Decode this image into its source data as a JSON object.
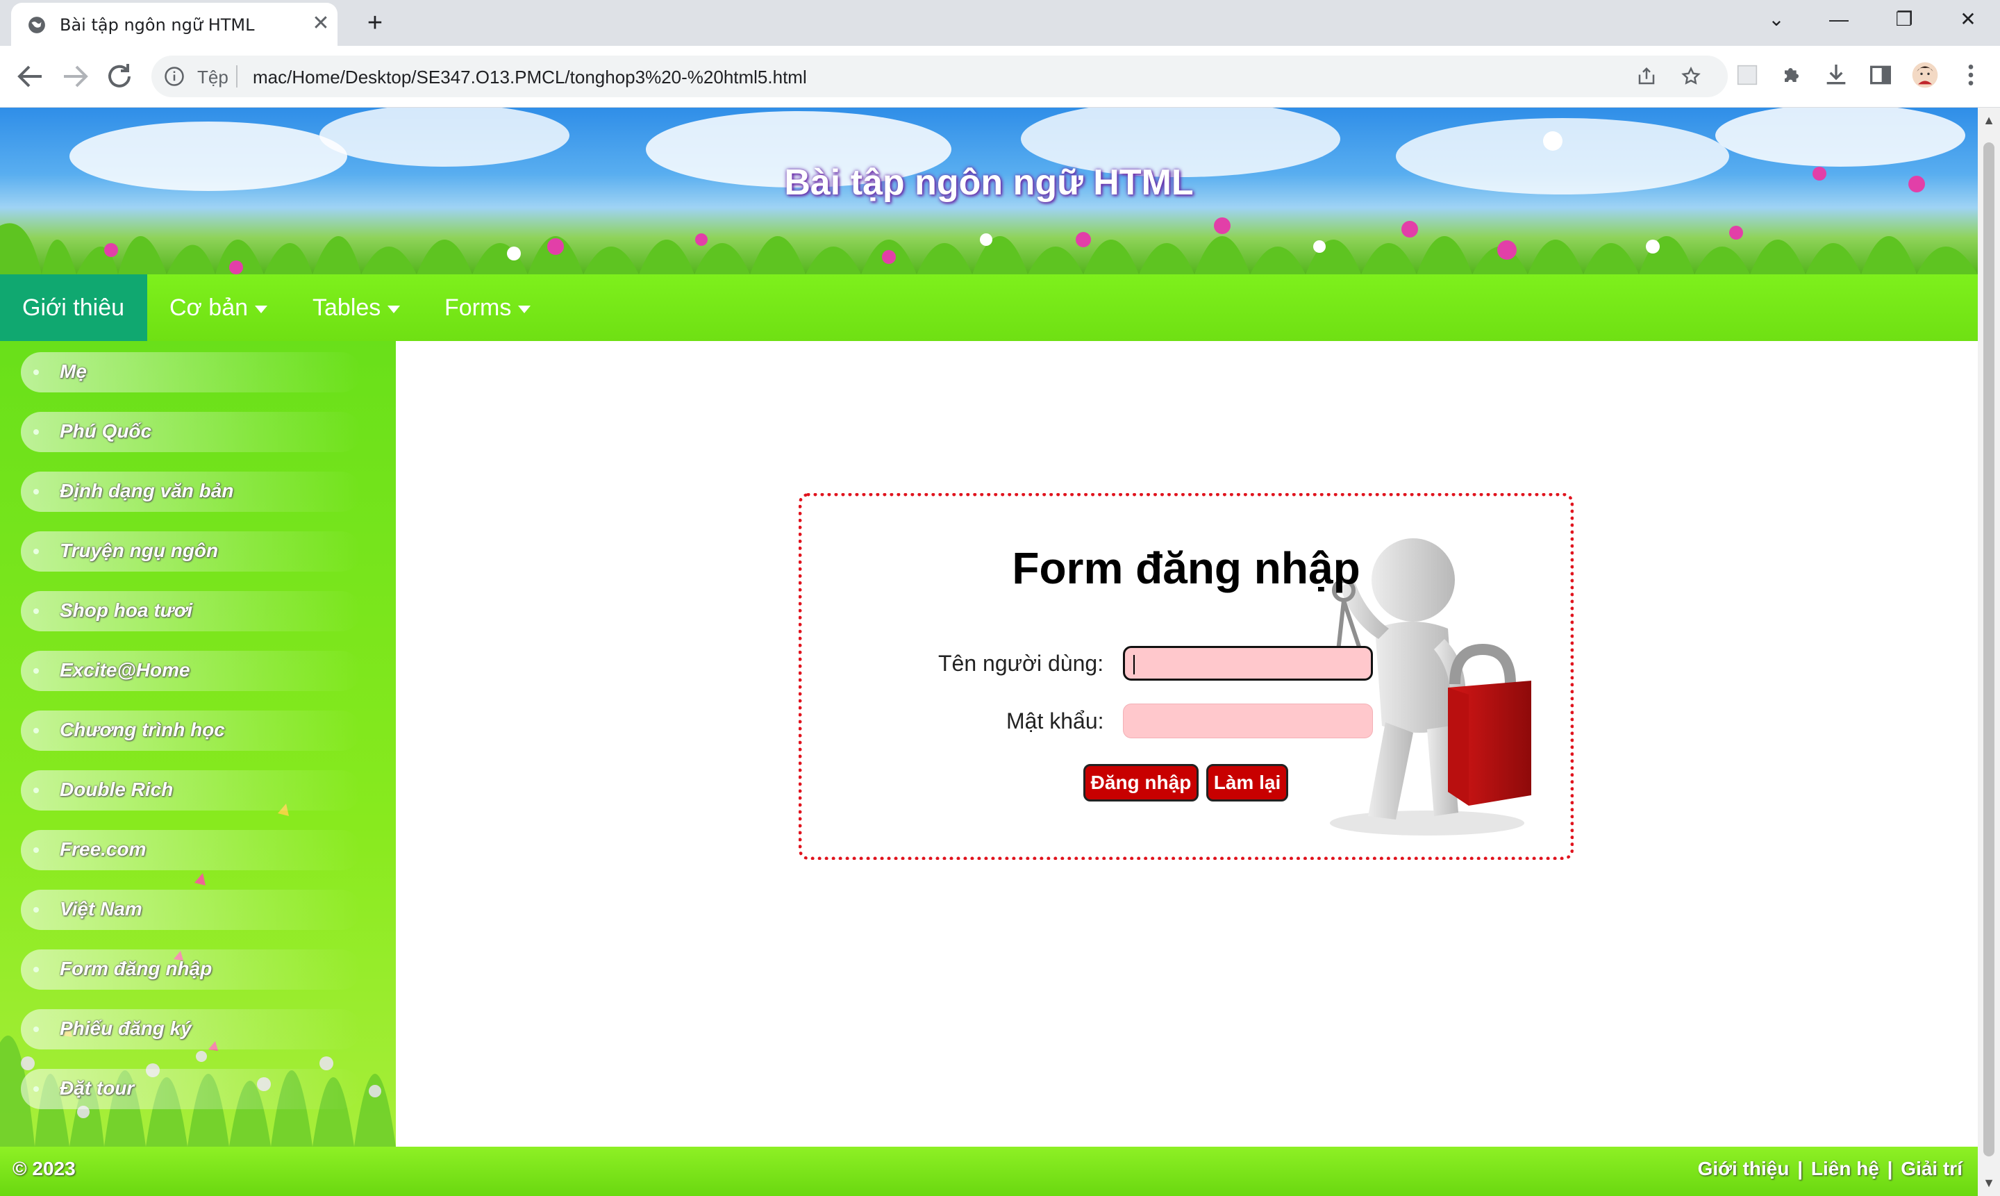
{
  "browser": {
    "tab_title": "Bài tập ngôn ngữ HTML",
    "close_glyph": "✕",
    "new_tab_glyph": "+",
    "minimize_glyph": "—",
    "restore_glyph": "❐",
    "window_close_glyph": "✕",
    "dropdown_glyph": "⌄",
    "site_info_label": "Tệp",
    "url": "mac/Home/Desktop/SE347.O13.PMCL/tonghop3%20-%20html5.html",
    "accent_color": "#1a73e8"
  },
  "header": {
    "title": "Bài tập ngôn ngữ HTML"
  },
  "menu": {
    "items": [
      {
        "label": "Giới thiêu",
        "active": true
      },
      {
        "label": "Cơ bản",
        "has_dropdown": true
      },
      {
        "label": "Tables",
        "has_dropdown": true
      },
      {
        "label": "Forms",
        "has_dropdown": true
      }
    ],
    "active_color": "#10a870"
  },
  "sidebar": {
    "items": [
      {
        "label": "Mẹ"
      },
      {
        "label": "Phú Quốc"
      },
      {
        "label": "Định dạng văn bản"
      },
      {
        "label": "Truyện ngụ ngôn"
      },
      {
        "label": "Shop hoa tươi"
      },
      {
        "label": "Excite@Home"
      },
      {
        "label": "Chương trình học"
      },
      {
        "label": "Double Rich"
      },
      {
        "label": "Free.com"
      },
      {
        "label": "Việt Nam"
      },
      {
        "label": "Form đăng nhập"
      },
      {
        "label": "Phiếu đăng ký"
      },
      {
        "label": "Đặt tour"
      }
    ]
  },
  "login_form": {
    "title": "Form đăng nhập",
    "username_label": "Tên người dùng:",
    "username_value": "",
    "password_label": "Mật khẩu:",
    "password_value": "",
    "login_button": "Đăng nhập",
    "reset_button": "Làm lại",
    "border_color": "#e0141e",
    "input_color": "#ffc8cc",
    "button_color": "#c80000"
  },
  "footer": {
    "copyright": "© 2023",
    "links": [
      "Giới thiệu",
      "Liên hệ",
      "Giải trí"
    ],
    "separator": "|"
  }
}
